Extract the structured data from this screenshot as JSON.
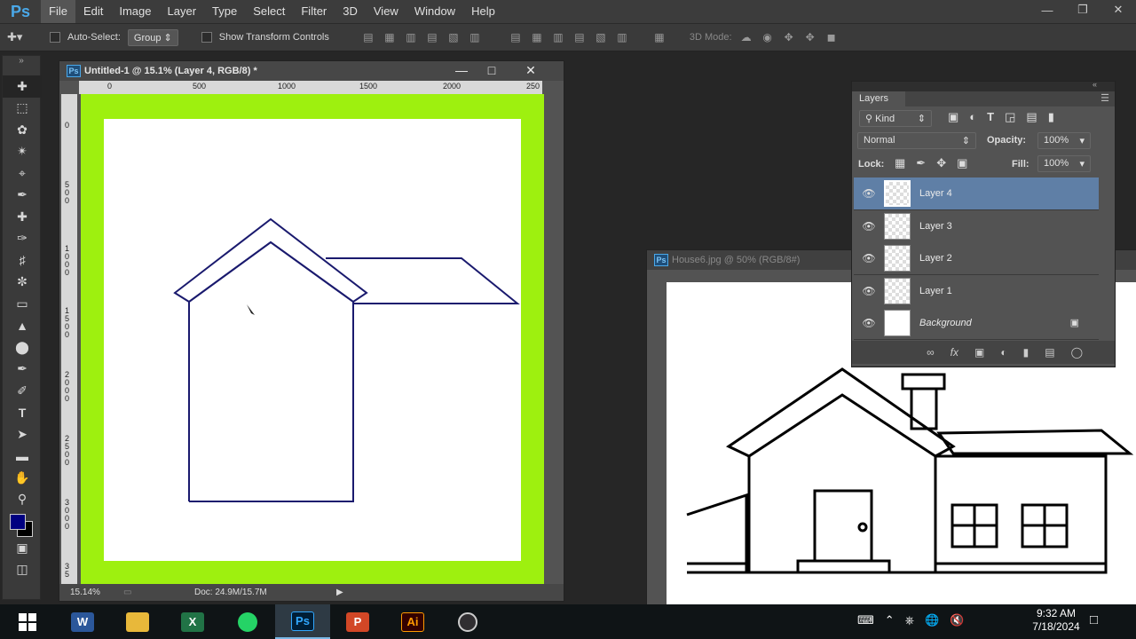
{
  "app": {
    "logo": "Ps"
  },
  "menu": {
    "items": [
      "File",
      "Edit",
      "Image",
      "Layer",
      "Type",
      "Select",
      "Filter",
      "3D",
      "View",
      "Window",
      "Help"
    ]
  },
  "window_controls": [
    "minimize",
    "restore",
    "close"
  ],
  "options_bar": {
    "move_icon": "move-tool-icon",
    "auto_select_label": "Auto-Select:",
    "auto_select_value": "Group",
    "transform_label": "Show Transform Controls",
    "mode_3d_label": "3D Mode:"
  },
  "toolbox": {
    "tools": [
      "move",
      "marquee",
      "lasso",
      "quick-select",
      "crop",
      "eyedropper",
      "healing",
      "brush",
      "clone-stamp",
      "history-brush",
      "eraser",
      "gradient",
      "blur",
      "dodge",
      "pen",
      "type",
      "path-select",
      "rectangle",
      "hand",
      "zoom"
    ],
    "foreground_color": "#000080",
    "background_color": "#000000"
  },
  "document": {
    "title": "Untitled-1 @ 15.1% (Layer 4, RGB/8) *",
    "ruler_h": [
      "0",
      "500",
      "1000",
      "1500",
      "2000",
      "250"
    ],
    "ruler_v": [
      "0",
      "500",
      "1000",
      "1500",
      "2000",
      "2500",
      "3000",
      "35"
    ],
    "zoom": "15.14%",
    "doc_size": "Doc: 24.9M/15.7M",
    "artboard_color": "#9ef00f"
  },
  "document2": {
    "title": "House6.jpg @ 50% (RGB/8#)"
  },
  "layers_panel": {
    "tab": "Layers",
    "filter_label": "Kind",
    "blend_mode": "Normal",
    "opacity_label": "Opacity:",
    "opacity_value": "100%",
    "lock_label": "Lock:",
    "fill_label": "Fill:",
    "fill_value": "100%",
    "layers": [
      {
        "name": "Layer 4",
        "selected": true
      },
      {
        "name": "Layer 3",
        "selected": false
      },
      {
        "name": "Layer 2",
        "selected": false
      },
      {
        "name": "Layer 1",
        "selected": false
      },
      {
        "name": "Background",
        "selected": false
      }
    ],
    "footer_icons": [
      "link-icon",
      "fx-icon",
      "mask-icon",
      "adjustment-icon",
      "folder-icon",
      "new-layer-icon",
      "trash-icon"
    ]
  },
  "taskbar": {
    "apps": [
      {
        "name": "Word",
        "letter": "W",
        "color": "#2b579a"
      },
      {
        "name": "File Explorer",
        "letter": "",
        "color": "#e8b83a"
      },
      {
        "name": "Excel",
        "letter": "X",
        "color": "#217346"
      },
      {
        "name": "WhatsApp",
        "letter": "",
        "color": "#25d366"
      },
      {
        "name": "Photoshop",
        "letter": "Ps",
        "color": "#001e36"
      },
      {
        "name": "PowerPoint",
        "letter": "P",
        "color": "#d24726"
      },
      {
        "name": "Illustrator",
        "letter": "Ai",
        "color": "#330000"
      },
      {
        "name": "OBS",
        "letter": "",
        "color": "#302e31"
      }
    ],
    "time": "9:32 AM",
    "date": "7/18/2024"
  }
}
